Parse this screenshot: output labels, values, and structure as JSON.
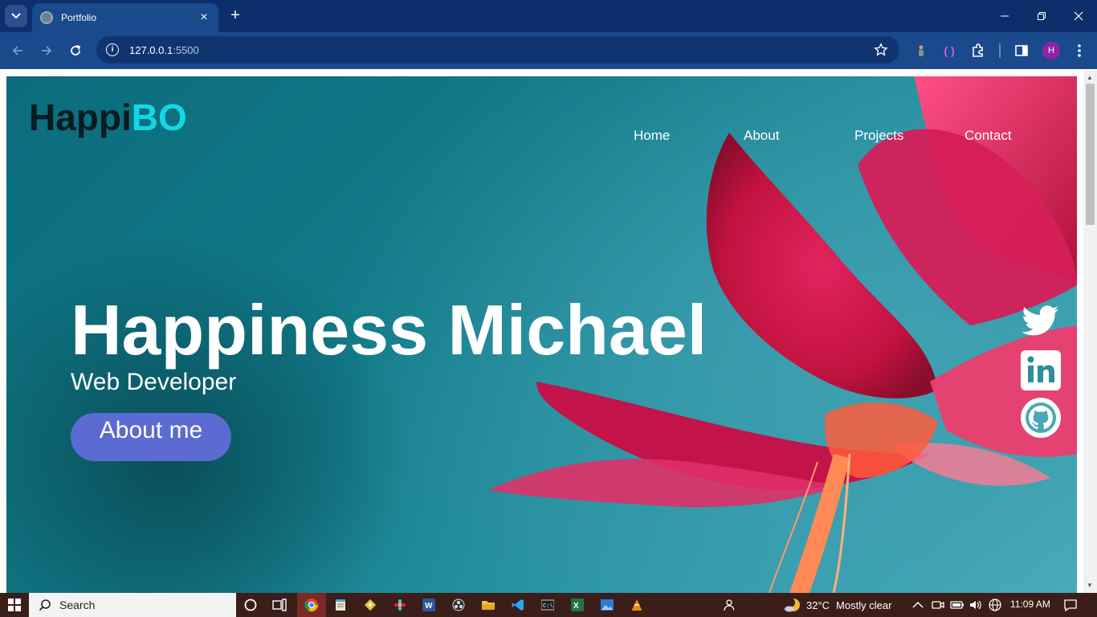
{
  "browser": {
    "tab_title": "Portfolio",
    "url_host": "127.0.0.1",
    "url_port": ":5500",
    "profile_initial": "H"
  },
  "site": {
    "logo_part1": "Happi",
    "logo_part2": "BO",
    "nav": [
      "Home",
      "About",
      "Projects",
      "Contact"
    ],
    "hero_name": "Happiness Michael",
    "hero_role": "Web Developer",
    "hero_button": "About me",
    "social": [
      "twitter-icon",
      "linkedin-icon",
      "github-icon"
    ],
    "colors": {
      "accent": "#14d7e6",
      "button": "#5b6bd1",
      "background": "#0b6c7c"
    }
  },
  "taskbar": {
    "search_label": "Search",
    "weather_temp": "32°C",
    "weather_desc": "Mostly clear",
    "time": "11:09 AM"
  }
}
